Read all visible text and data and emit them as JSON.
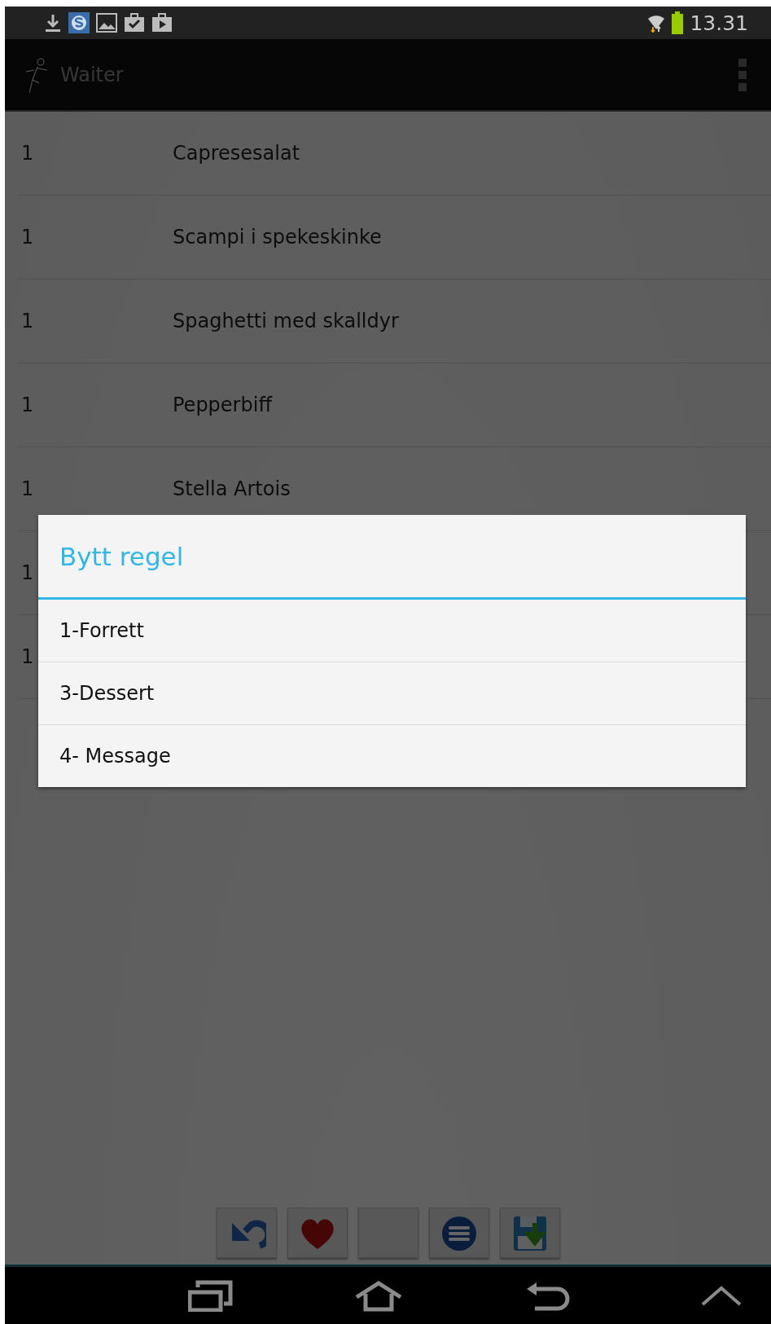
{
  "status_bar": {
    "time": "13.31"
  },
  "action_bar": {
    "title": "Waiter"
  },
  "order_rows": [
    {
      "quantity": "1",
      "item": "Capresesalat"
    },
    {
      "quantity": "1",
      "item": "Scampi i spekeskinke"
    },
    {
      "quantity": "1",
      "item": "Spaghetti med skalldyr"
    },
    {
      "quantity": "1",
      "item": "Pepperbiff"
    },
    {
      "quantity": "1",
      "item": "Stella Artois"
    },
    {
      "quantity": "1"
    },
    {
      "quantity": "1"
    }
  ],
  "dialog": {
    "title": "Bytt regel",
    "options": [
      "1-Forrett",
      "3-Dessert",
      "4- Message"
    ]
  },
  "toolbar": {
    "buttons": [
      {
        "kind": "undo"
      },
      {
        "kind": "heart"
      },
      {
        "kind": "blank"
      },
      {
        "kind": "menu"
      },
      {
        "kind": "save"
      }
    ]
  }
}
